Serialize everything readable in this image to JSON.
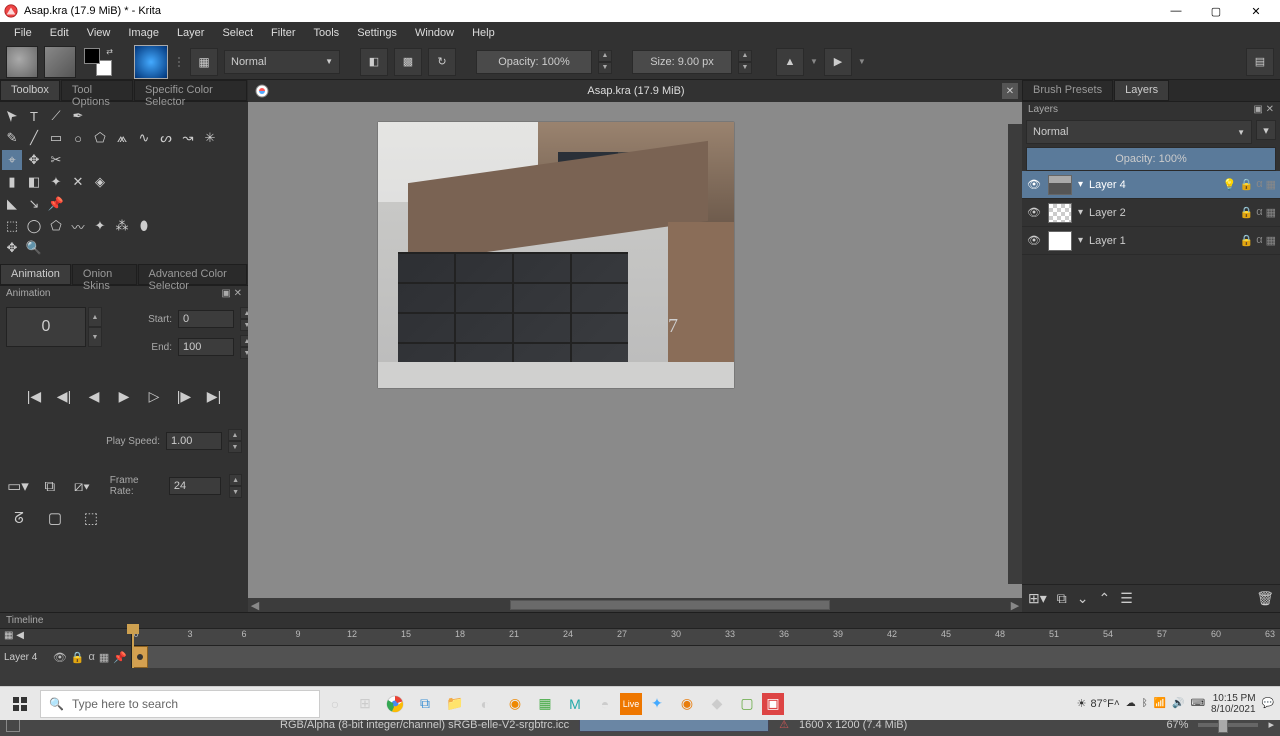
{
  "titlebar": {
    "text": "Asap.kra (17.9 MiB) * - Krita"
  },
  "menu": {
    "items": [
      "File",
      "Edit",
      "View",
      "Image",
      "Layer",
      "Select",
      "Filter",
      "Tools",
      "Settings",
      "Window",
      "Help"
    ]
  },
  "toolbar": {
    "blend_mode": "Normal",
    "opacity_label": "Opacity:  100%",
    "size_label": "Size:  9.00 px"
  },
  "left_tabs": {
    "tab1": "Toolbox",
    "tab2": "Tool Options",
    "tab3": "Specific Color Selector"
  },
  "anim_tabs": {
    "tab1": "Animation",
    "tab2": "Onion Skins",
    "tab3": "Advanced Color Selector"
  },
  "animation": {
    "panel_title": "Animation",
    "current_frame": "0",
    "start_label": "Start:",
    "start_value": "0",
    "end_label": "End:",
    "end_value": "100",
    "play_speed_label": "Play Speed:",
    "play_speed_value": "1.00",
    "frame_rate_label": "Frame Rate:",
    "frame_rate_value": "24"
  },
  "document": {
    "tab_title": "Asap.kra (17.9 MiB)",
    "house_number": "7"
  },
  "right_tabs": {
    "tab1": "Brush Presets",
    "tab2": "Layers"
  },
  "layers": {
    "header": "Layers",
    "blend_mode": "Normal",
    "opacity_label": "Opacity:  100%",
    "items": [
      {
        "name": "Layer 4"
      },
      {
        "name": "Layer 2"
      },
      {
        "name": "Layer 1"
      }
    ]
  },
  "timeline": {
    "title": "Timeline",
    "layer_name": "Layer 4",
    "ticks": [
      "0",
      "3",
      "6",
      "9",
      "12",
      "15",
      "18",
      "21",
      "24",
      "27",
      "30",
      "33",
      "36",
      "39",
      "42",
      "45",
      "48",
      "51",
      "54",
      "57",
      "60",
      "63"
    ]
  },
  "statusbar": {
    "color_info": "RGB/Alpha (8-bit integer/channel)  sRGB-elle-V2-srgbtrc.icc",
    "dimensions": "1600 x 1200 (7.4 MiB)",
    "zoom": "67%"
  },
  "taskbar": {
    "search_placeholder": "Type here to search",
    "weather_temp": "87°F",
    "time": "10:15 PM",
    "date": "8/10/2021"
  }
}
